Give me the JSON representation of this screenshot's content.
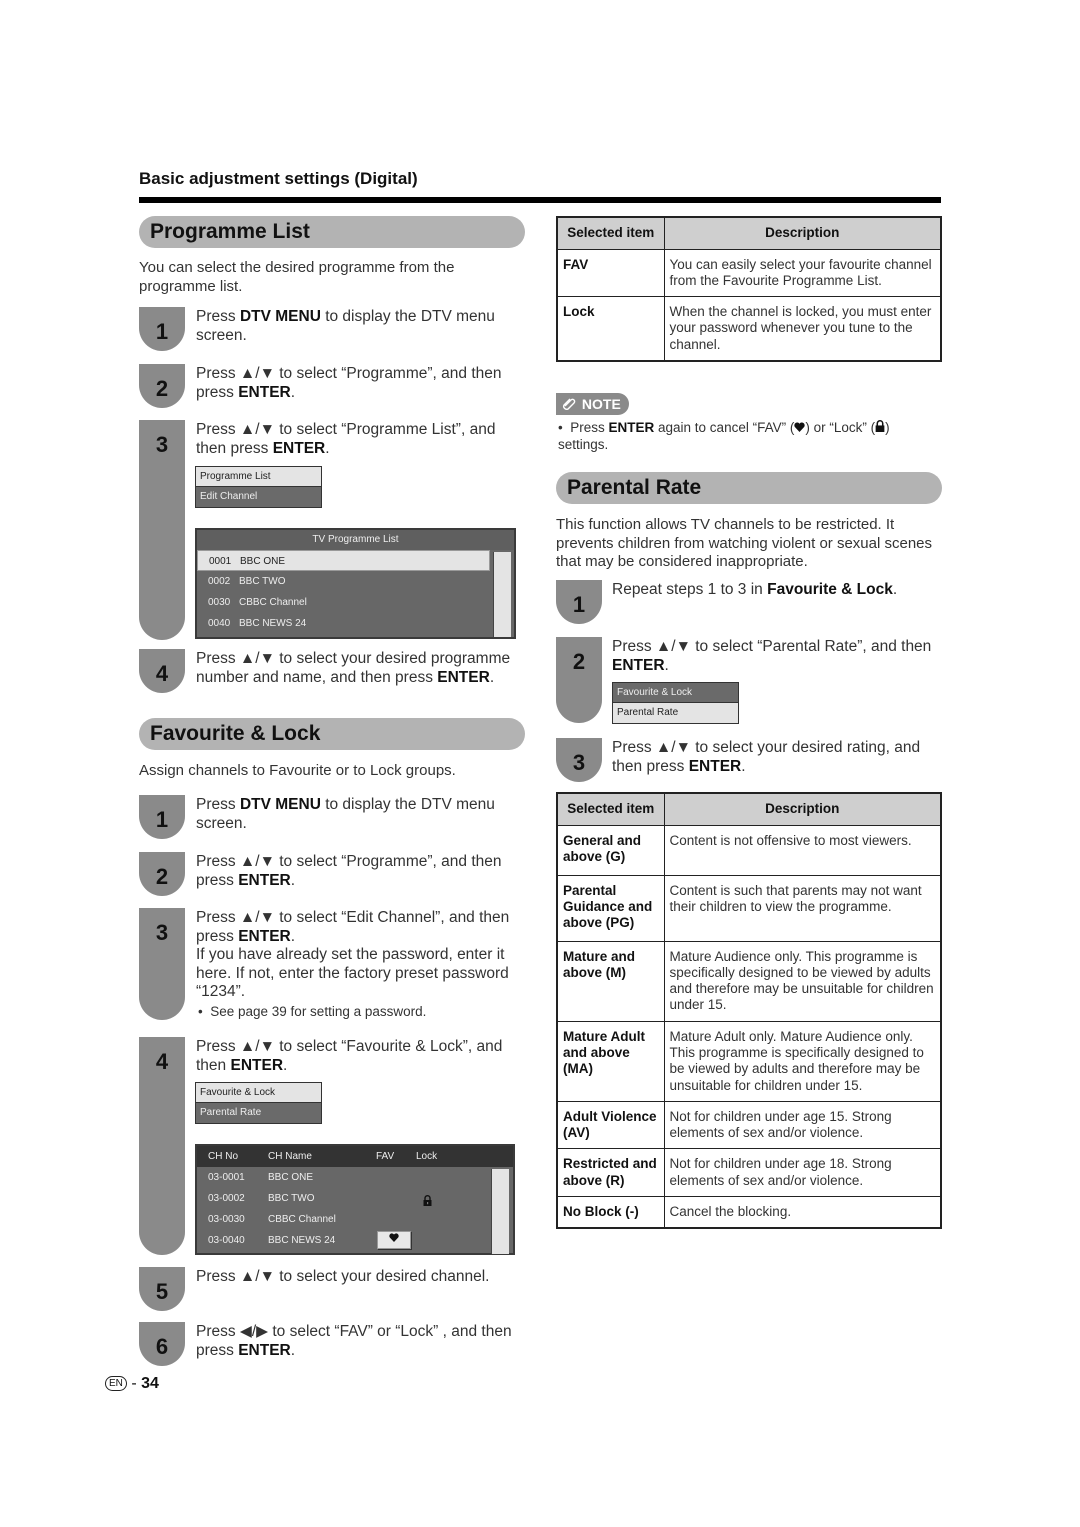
{
  "header": {
    "title": "Basic adjustment settings (Digital)"
  },
  "programme_list": {
    "title": "Programme List",
    "intro": "You can select the desired programme from the programme list.",
    "steps": [
      {
        "num": "1",
        "pre": "Press ",
        "bold": "DTV MENU",
        "post": " to display the DTV menu screen."
      },
      {
        "num": "2",
        "pre": "Press ▲/▼ to select “Programme”, and then press ",
        "bold": "ENTER",
        "post": "."
      },
      {
        "num": "3",
        "pre": "Press ▲/▼ to select “Programme List”, and then press ",
        "bold": "ENTER",
        "post": "."
      },
      {
        "num": "4",
        "pre": "Press ▲/▼ to select your desired programme number and name, and then press ",
        "bold": "ENTER",
        "post": "."
      }
    ],
    "menu": [
      "Programme List",
      "Edit Channel"
    ],
    "tv_list": {
      "title": "TV Programme List",
      "rows": [
        {
          "num": "0001",
          "name": "BBC ONE"
        },
        {
          "num": "0002",
          "name": "BBC TWO"
        },
        {
          "num": "0030",
          "name": "CBBC Channel"
        },
        {
          "num": "0040",
          "name": "BBC NEWS 24"
        }
      ]
    }
  },
  "favourite_lock": {
    "title": "Favourite & Lock",
    "intro": "Assign channels to Favourite or to Lock groups.",
    "steps": [
      {
        "num": "1",
        "pre": "Press ",
        "bold": "DTV MENU",
        "post": " to display the DTV menu screen."
      },
      {
        "num": "2",
        "pre": "Press ▲/▼ to select “Programme”, and then press ",
        "bold": "ENTER",
        "post": "."
      },
      {
        "num": "3",
        "pre": "Press ▲/▼ to select “Edit Channel”, and then press ",
        "bold": "ENTER",
        "post": ".",
        "extra": "If you have already set the password, enter it here. If not, enter the factory preset password “1234”.",
        "bullet": "See page 39 for setting a password."
      },
      {
        "num": "4",
        "pre": "Press ▲/▼ to select “Favourite & Lock”, and then ",
        "bold": "ENTER",
        "post": "."
      },
      {
        "num": "5",
        "pre": "Press ▲/▼ to select your desired channel.",
        "bold": "",
        "post": ""
      },
      {
        "num": "6",
        "pre": "Press ◀/▶ to select “FAV” or “Lock” , and then press ",
        "bold": "ENTER",
        "post": "."
      }
    ],
    "menu": [
      "Favourite & Lock",
      "Parental Rate"
    ],
    "channel_table": {
      "headers": [
        "CH No",
        "CH Name",
        "FAV",
        "Lock"
      ],
      "rows": [
        {
          "no": "03-0001",
          "name": "BBC ONE",
          "fav": false,
          "lock": false
        },
        {
          "no": "03-0002",
          "name": "BBC TWO",
          "fav": false,
          "lock": true
        },
        {
          "no": "03-0030",
          "name": "CBBC Channel",
          "fav": false,
          "lock": false
        },
        {
          "no": "03-0040",
          "name": "BBC NEWS 24",
          "fav": true,
          "lock": false
        }
      ]
    }
  },
  "fav_lock_table": {
    "headers": [
      "Selected item",
      "Description"
    ],
    "rows": [
      {
        "item": "FAV",
        "desc": "You can easily select your favourite channel from the Favourite Programme List."
      },
      {
        "item": "Lock",
        "desc": "When the channel is locked, you must enter your password whenever you tune to the channel."
      }
    ]
  },
  "note": {
    "label": "NOTE",
    "pre": "Press ",
    "bold": "ENTER",
    "mid": " again to cancel “FAV” (",
    "mid2": ") or “Lock” (",
    "post": ") settings."
  },
  "parental_rate": {
    "title": "Parental Rate",
    "intro": "This function allows TV channels to be restricted. It prevents children from watching violent or sexual scenes that may be considered inappropriate.",
    "steps": [
      {
        "num": "1",
        "pre": "Repeat steps 1 to 3 in ",
        "bold": "Favourite & Lock",
        "post": "."
      },
      {
        "num": "2",
        "pre": "Press ▲/▼ to select “Parental Rate”, and then ",
        "bold": "ENTER",
        "post": "."
      },
      {
        "num": "3",
        "pre": "Press ▲/▼ to select your desired rating, and then press ",
        "bold": "ENTER",
        "post": "."
      }
    ],
    "menu": [
      "Favourite & Lock",
      "Parental Rate"
    ],
    "table": {
      "headers": [
        "Selected item",
        "Description"
      ],
      "rows": [
        {
          "item": "General and above (G)",
          "desc": "Content is not offensive to most viewers."
        },
        {
          "item": "Parental Guidance and above (PG)",
          "desc": "Content is such that parents may not want their children to view the programme."
        },
        {
          "item": "Mature and above (M)",
          "desc": "Mature Audience only. This programme is specifically designed to be viewed by adults and therefore may be unsuitable for children under 15."
        },
        {
          "item": "Mature Adult and above (MA)",
          "desc": "Mature Adult only. Mature Audience only. This programme is specifically designed to be viewed by adults and therefore may be unsuitable for children under 15."
        },
        {
          "item": "Adult Violence (AV)",
          "desc": "Not for children under age 15. Strong elements of sex and/or violence."
        },
        {
          "item": "Restricted and above (R)",
          "desc": "Not for children under age 18. Strong elements of sex and/or violence."
        },
        {
          "item": "No Block (-)",
          "desc": "Cancel the blocking."
        }
      ]
    }
  },
  "footer": {
    "lang": "EN",
    "page": "34"
  }
}
